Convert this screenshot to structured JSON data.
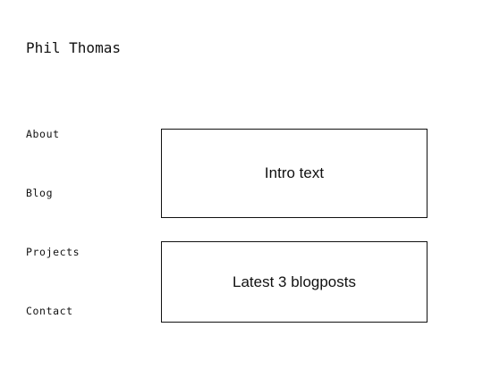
{
  "site": {
    "title": "Phil Thomas"
  },
  "nav": {
    "items": [
      {
        "label": "About"
      },
      {
        "label": "Blog"
      },
      {
        "label": "Projects"
      },
      {
        "label": "Contact"
      }
    ]
  },
  "main": {
    "intro_placeholder": "Intro text",
    "blog_placeholder": "Latest 3 blogposts"
  }
}
